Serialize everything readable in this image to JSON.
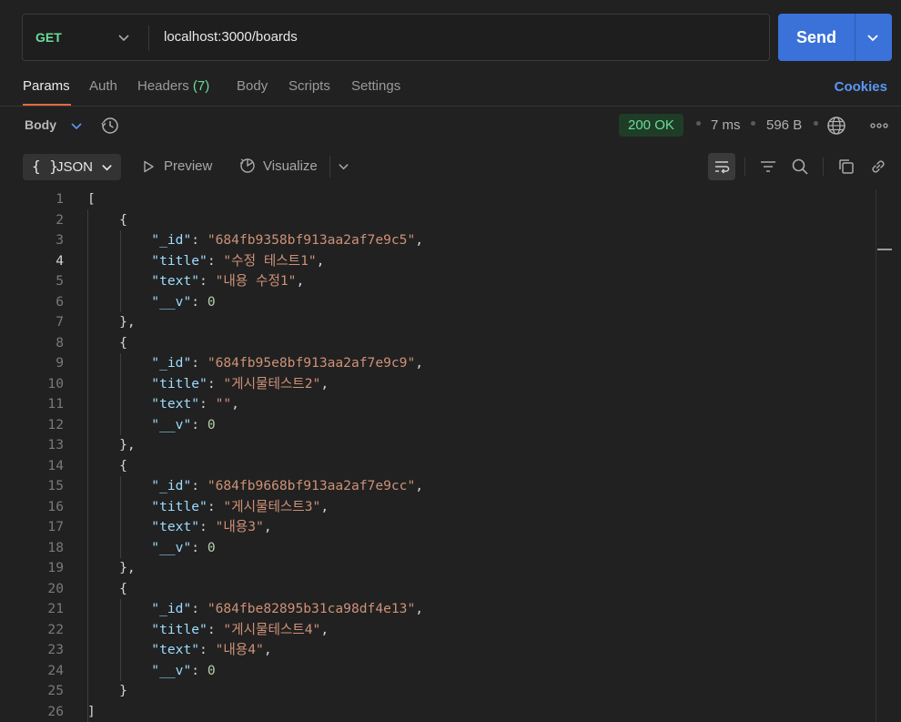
{
  "request": {
    "method": "GET",
    "url": "localhost:3000/boards",
    "send_label": "Send"
  },
  "tabs": [
    {
      "label": "Params",
      "active": true
    },
    {
      "label": "Auth"
    },
    {
      "label": "Headers",
      "count": "(7)"
    },
    {
      "label": "Body"
    },
    {
      "label": "Scripts"
    },
    {
      "label": "Settings"
    }
  ],
  "cookies_label": "Cookies",
  "response": {
    "section_label": "Body",
    "status": "200 OK",
    "time": "7 ms",
    "size": "596 B",
    "format_label": "JSON",
    "format_braces": "{ }",
    "preview_label": "Preview",
    "visualize_label": "Visualize"
  },
  "code_lines": [
    [
      {
        "t": "[",
        "c": "punc"
      }
    ],
    [
      {
        "t": "    {",
        "c": "punc"
      }
    ],
    [
      {
        "t": "        ",
        "c": "punc"
      },
      {
        "t": "\"_id\"",
        "c": "key"
      },
      {
        "t": ": ",
        "c": "punc"
      },
      {
        "t": "\"684fb9358bf913aa2af7e9c5\"",
        "c": "str"
      },
      {
        "t": ",",
        "c": "punc"
      }
    ],
    [
      {
        "t": "        ",
        "c": "punc"
      },
      {
        "t": "\"title\"",
        "c": "key"
      },
      {
        "t": ": ",
        "c": "punc"
      },
      {
        "t": "\"수정 테스트1\"",
        "c": "str"
      },
      {
        "t": ",",
        "c": "punc"
      }
    ],
    [
      {
        "t": "        ",
        "c": "punc"
      },
      {
        "t": "\"text\"",
        "c": "key"
      },
      {
        "t": ": ",
        "c": "punc"
      },
      {
        "t": "\"내용 수정1\"",
        "c": "str"
      },
      {
        "t": ",",
        "c": "punc"
      }
    ],
    [
      {
        "t": "        ",
        "c": "punc"
      },
      {
        "t": "\"__v\"",
        "c": "key"
      },
      {
        "t": ": ",
        "c": "punc"
      },
      {
        "t": "0",
        "c": "num"
      }
    ],
    [
      {
        "t": "    },",
        "c": "punc"
      }
    ],
    [
      {
        "t": "    {",
        "c": "punc"
      }
    ],
    [
      {
        "t": "        ",
        "c": "punc"
      },
      {
        "t": "\"_id\"",
        "c": "key"
      },
      {
        "t": ": ",
        "c": "punc"
      },
      {
        "t": "\"684fb95e8bf913aa2af7e9c9\"",
        "c": "str"
      },
      {
        "t": ",",
        "c": "punc"
      }
    ],
    [
      {
        "t": "        ",
        "c": "punc"
      },
      {
        "t": "\"title\"",
        "c": "key"
      },
      {
        "t": ": ",
        "c": "punc"
      },
      {
        "t": "\"게시물테스트2\"",
        "c": "str"
      },
      {
        "t": ",",
        "c": "punc"
      }
    ],
    [
      {
        "t": "        ",
        "c": "punc"
      },
      {
        "t": "\"text\"",
        "c": "key"
      },
      {
        "t": ": ",
        "c": "punc"
      },
      {
        "t": "\"\"",
        "c": "str"
      },
      {
        "t": ",",
        "c": "punc"
      }
    ],
    [
      {
        "t": "        ",
        "c": "punc"
      },
      {
        "t": "\"__v\"",
        "c": "key"
      },
      {
        "t": ": ",
        "c": "punc"
      },
      {
        "t": "0",
        "c": "num"
      }
    ],
    [
      {
        "t": "    },",
        "c": "punc"
      }
    ],
    [
      {
        "t": "    {",
        "c": "punc"
      }
    ],
    [
      {
        "t": "        ",
        "c": "punc"
      },
      {
        "t": "\"_id\"",
        "c": "key"
      },
      {
        "t": ": ",
        "c": "punc"
      },
      {
        "t": "\"684fb9668bf913aa2af7e9cc\"",
        "c": "str"
      },
      {
        "t": ",",
        "c": "punc"
      }
    ],
    [
      {
        "t": "        ",
        "c": "punc"
      },
      {
        "t": "\"title\"",
        "c": "key"
      },
      {
        "t": ": ",
        "c": "punc"
      },
      {
        "t": "\"게시물테스트3\"",
        "c": "str"
      },
      {
        "t": ",",
        "c": "punc"
      }
    ],
    [
      {
        "t": "        ",
        "c": "punc"
      },
      {
        "t": "\"text\"",
        "c": "key"
      },
      {
        "t": ": ",
        "c": "punc"
      },
      {
        "t": "\"내용3\"",
        "c": "str"
      },
      {
        "t": ",",
        "c": "punc"
      }
    ],
    [
      {
        "t": "        ",
        "c": "punc"
      },
      {
        "t": "\"__v\"",
        "c": "key"
      },
      {
        "t": ": ",
        "c": "punc"
      },
      {
        "t": "0",
        "c": "num"
      }
    ],
    [
      {
        "t": "    },",
        "c": "punc"
      }
    ],
    [
      {
        "t": "    {",
        "c": "punc"
      }
    ],
    [
      {
        "t": "        ",
        "c": "punc"
      },
      {
        "t": "\"_id\"",
        "c": "key"
      },
      {
        "t": ": ",
        "c": "punc"
      },
      {
        "t": "\"684fbe82895b31ca98df4e13\"",
        "c": "str"
      },
      {
        "t": ",",
        "c": "punc"
      }
    ],
    [
      {
        "t": "        ",
        "c": "punc"
      },
      {
        "t": "\"title\"",
        "c": "key"
      },
      {
        "t": ": ",
        "c": "punc"
      },
      {
        "t": "\"게시물테스트4\"",
        "c": "str"
      },
      {
        "t": ",",
        "c": "punc"
      }
    ],
    [
      {
        "t": "        ",
        "c": "punc"
      },
      {
        "t": "\"text\"",
        "c": "key"
      },
      {
        "t": ": ",
        "c": "punc"
      },
      {
        "t": "\"내용4\"",
        "c": "str"
      },
      {
        "t": ",",
        "c": "punc"
      }
    ],
    [
      {
        "t": "        ",
        "c": "punc"
      },
      {
        "t": "\"__v\"",
        "c": "key"
      },
      {
        "t": ": ",
        "c": "punc"
      },
      {
        "t": "0",
        "c": "num"
      }
    ],
    [
      {
        "t": "    }",
        "c": "punc"
      }
    ],
    [
      {
        "t": "]",
        "c": "punc"
      }
    ]
  ],
  "active_line": 4,
  "colors": {
    "accent": "#3b72d9",
    "method": "#6bdd9a",
    "tab_underline": "#e06c3c",
    "link": "#5b96f5"
  }
}
